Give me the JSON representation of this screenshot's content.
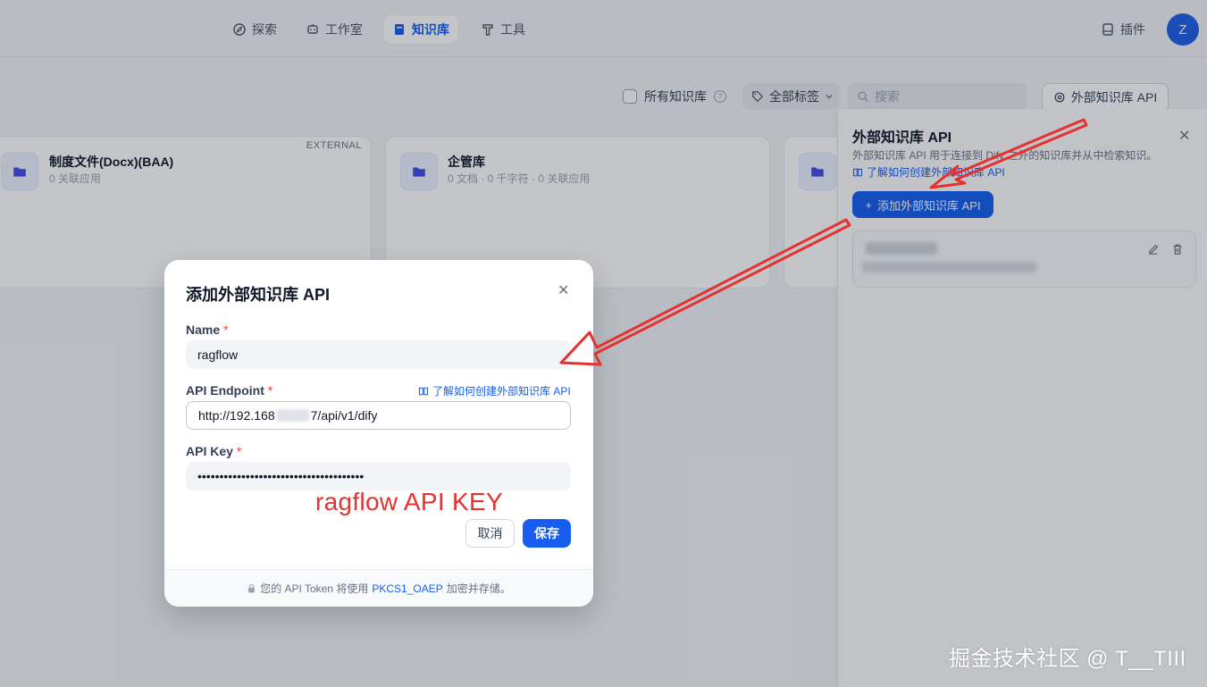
{
  "nav": {
    "tabs": [
      {
        "label": "探索",
        "icon": "compass-icon"
      },
      {
        "label": "工作室",
        "icon": "robot-icon"
      },
      {
        "label": "知识库",
        "icon": "book-icon"
      },
      {
        "label": "工具",
        "icon": "hammer-icon"
      }
    ],
    "plugin_label": "插件",
    "avatar_initial": "Z"
  },
  "toolbar": {
    "all_kb_label": "所有知识库",
    "tags_label": "全部标签",
    "search_placeholder": "搜索",
    "ext_api_label": "外部知识库 API"
  },
  "cards": [
    {
      "title": "制度文件(Docx)(BAA)",
      "subtitle": "0 关联应用",
      "badge": "EXTERNAL"
    },
    {
      "title": "企管库",
      "subtitle": "0 文档 · 0 千字符 · 0 关联应用",
      "badge": ""
    },
    {
      "title": "",
      "subtitle": "",
      "badge": ""
    }
  ],
  "side_panel": {
    "title": "外部知识库 API",
    "description": "外部知识库 API 用于连接到 Dify 之外的知识库并从中检索知识。",
    "doc_link": "了解如何创建外部知识库 API",
    "add_button": "添加外部知识库 API"
  },
  "modal": {
    "title": "添加外部知识库 API",
    "name_label": "Name",
    "name_value": "ragflow",
    "endpoint_label": "API Endpoint",
    "endpoint_prefix": "http://192.168",
    "endpoint_suffix": "7/api/v1/dify",
    "doc_link": "了解如何创建外部知识库 API",
    "apikey_label": "API Key",
    "apikey_value": "••••••••••••••••••••••••••••••••••••••",
    "cancel_label": "取消",
    "save_label": "保存",
    "footer_prefix": "您的 API Token 将使用",
    "footer_accent": "PKCS1_OAEP",
    "footer_suffix": "加密并存储。"
  },
  "annotation": {
    "text": "ragflow API KEY",
    "color": "#e5312f"
  },
  "watermark": "掘金技术社区 @ T__TIII",
  "colors": {
    "primary": "#155eef",
    "arrow": "#e5312f"
  }
}
